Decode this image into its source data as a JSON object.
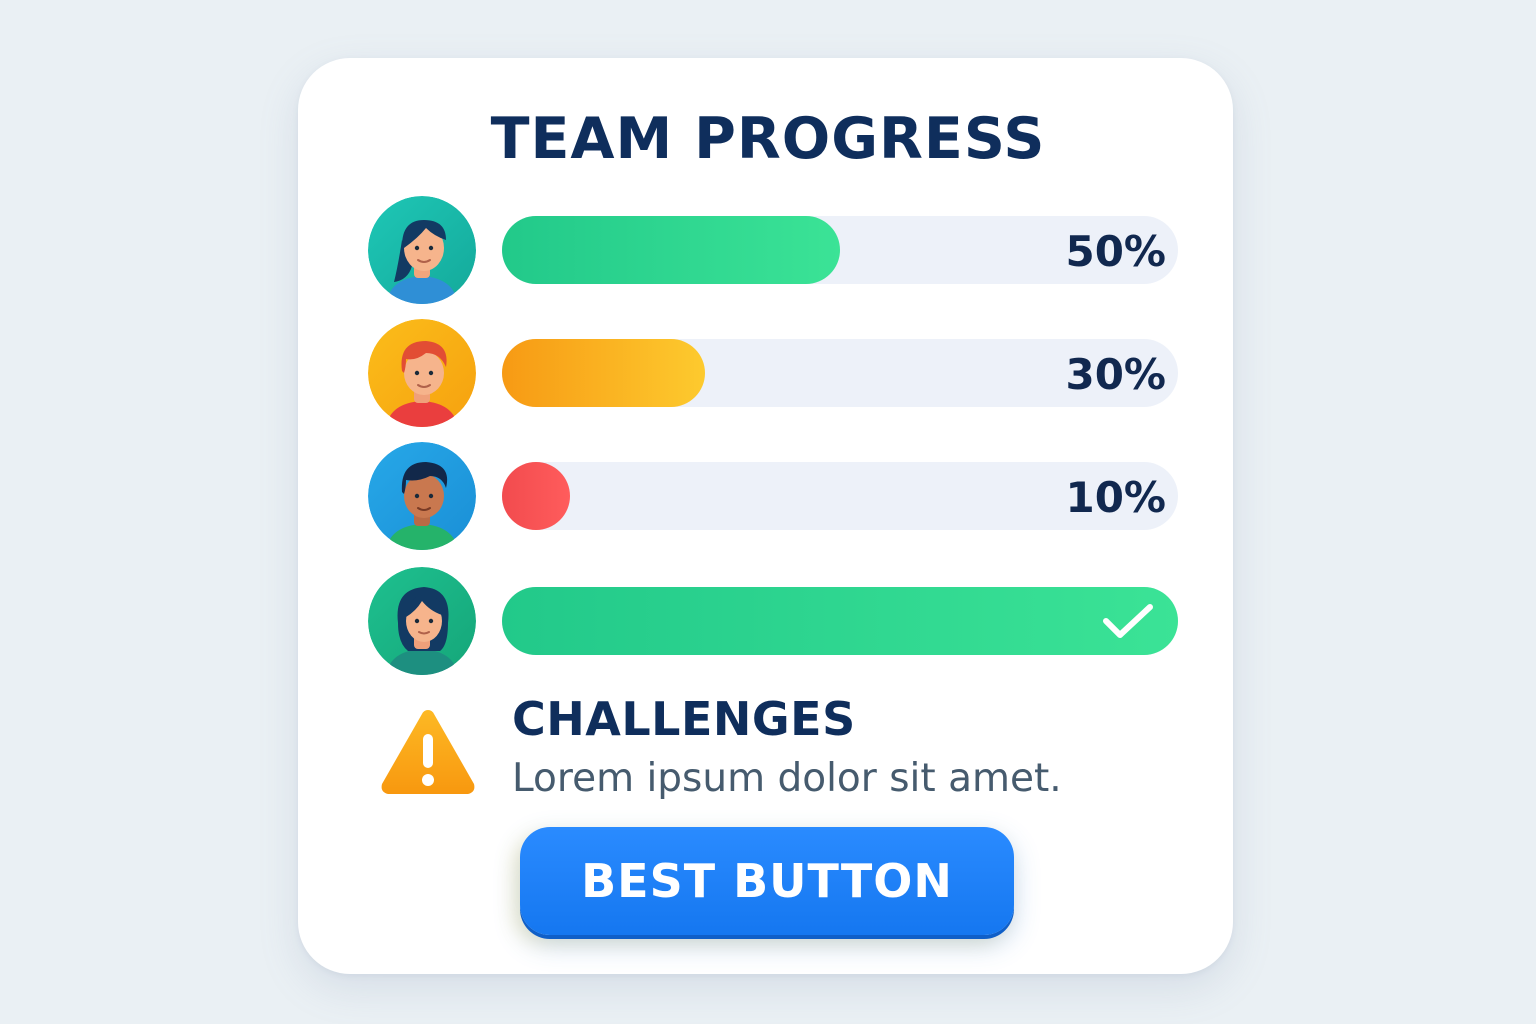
{
  "header": {
    "title": "TEAM PROGRESS"
  },
  "members": [
    {
      "avatar": "woman-ponytail-avatar",
      "progress": 0.5,
      "progress_label": "50%",
      "fill_color": "#22c98a",
      "status": "in-progress"
    },
    {
      "avatar": "man-red-hair-avatar",
      "progress": 0.3,
      "progress_label": "30%",
      "fill_color": "#fbb41f",
      "status": "in-progress"
    },
    {
      "avatar": "man-dark-hair-avatar",
      "progress": 0.1,
      "progress_label": "10%",
      "fill_color": "#f24b4e",
      "status": "in-progress"
    },
    {
      "avatar": "woman-long-hair-avatar",
      "progress": 1.0,
      "progress_label": "",
      "fill_color": "#22c98a",
      "status": "complete",
      "icon": "check-icon"
    }
  ],
  "challenges": {
    "icon": "warning-icon",
    "title": "CHALLENGES",
    "text": "Lorem ipsum dolor sit amet."
  },
  "button": {
    "label": "BEST BUTTON",
    "color": "#1a7ff5"
  }
}
